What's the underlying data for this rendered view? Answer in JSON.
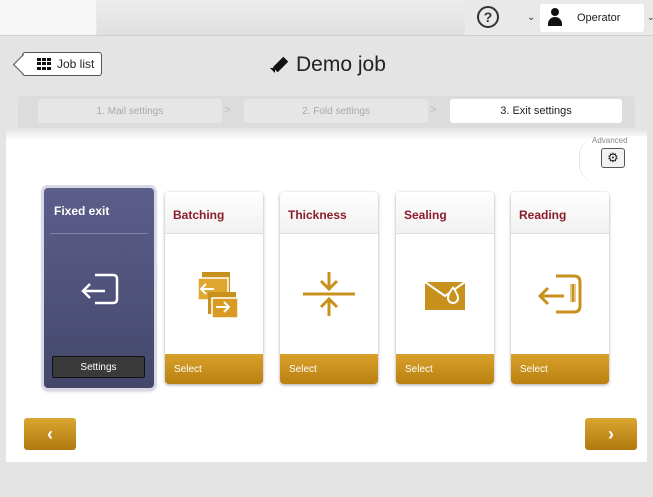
{
  "topbar": {
    "help_glyph": "?",
    "chevron_glyph": "⌄",
    "operator_label": "Operator"
  },
  "header": {
    "job_list_label": "Job list",
    "title": "Demo job"
  },
  "steps": [
    {
      "label": "1. Mail settings",
      "state": "inactive"
    },
    {
      "label": "2. Fold settings",
      "state": "inactive"
    },
    {
      "label": "3. Exit settings",
      "state": "active"
    }
  ],
  "step_separator": ">",
  "advanced": {
    "label": "Advanced",
    "gear_glyph": "⚙"
  },
  "cards": [
    {
      "title": "Fixed exit",
      "button": "Settings",
      "selected": true,
      "icon": "exit-arrow-icon"
    },
    {
      "title": "Batching",
      "button": "Select",
      "selected": false,
      "icon": "batching-icon"
    },
    {
      "title": "Thickness",
      "button": "Select",
      "selected": false,
      "icon": "thickness-icon"
    },
    {
      "title": "Sealing",
      "button": "Select",
      "selected": false,
      "icon": "sealing-icon"
    },
    {
      "title": "Reading",
      "button": "Select",
      "selected": false,
      "icon": "reading-icon"
    }
  ],
  "nav": {
    "prev_glyph": "‹",
    "next_glyph": "›"
  },
  "colors": {
    "accent_gold": "#c8901c",
    "title_red": "#8b1c2a",
    "selected_card": "#4f5179"
  }
}
